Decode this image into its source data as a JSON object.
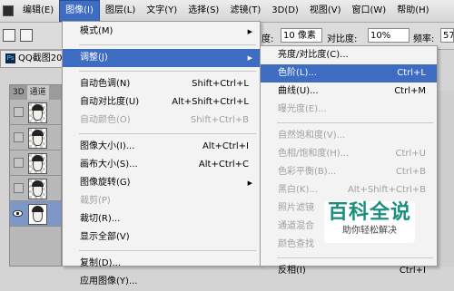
{
  "menubar": {
    "items": [
      "编辑(E)",
      "图像(I)",
      "图层(L)",
      "文字(Y)",
      "选择(S)",
      "滤镜(T)",
      "3D(D)",
      "视图(V)",
      "窗口(W)",
      "帮助(H)"
    ],
    "active_index": 1
  },
  "options": {
    "tolerance_label": "度:",
    "tolerance_value": "10 像素",
    "contrast_label": "对比度:",
    "contrast_value": "10%",
    "frequency_label": "频率:",
    "frequency_value": "57"
  },
  "doc_tab": {
    "ps": "Ps",
    "title": "QQ截图20"
  },
  "layers_panel": {
    "tabs": [
      "3D",
      "通道"
    ],
    "row_count": 5
  },
  "image_menu": {
    "items": [
      {
        "label": "模式(M)",
        "shortcut": "",
        "submenu": true,
        "disabled": false,
        "highlight": false
      },
      {
        "sep": true
      },
      {
        "label": "调整(J)",
        "shortcut": "",
        "submenu": true,
        "disabled": false,
        "highlight": true
      },
      {
        "sep": true
      },
      {
        "label": "自动色调(N)",
        "shortcut": "Shift+Ctrl+L",
        "submenu": false,
        "disabled": false,
        "highlight": false
      },
      {
        "label": "自动对比度(U)",
        "shortcut": "Alt+Shift+Ctrl+L",
        "submenu": false,
        "disabled": false,
        "highlight": false
      },
      {
        "label": "自动颜色(O)",
        "shortcut": "Shift+Ctrl+B",
        "submenu": false,
        "disabled": true,
        "highlight": false
      },
      {
        "sep": true
      },
      {
        "label": "图像大小(I)...",
        "shortcut": "Alt+Ctrl+I",
        "submenu": false,
        "disabled": false,
        "highlight": false
      },
      {
        "label": "画布大小(S)...",
        "shortcut": "Alt+Ctrl+C",
        "submenu": false,
        "disabled": false,
        "highlight": false
      },
      {
        "label": "图像旋转(G)",
        "shortcut": "",
        "submenu": true,
        "disabled": false,
        "highlight": false
      },
      {
        "label": "裁剪(P)",
        "shortcut": "",
        "submenu": false,
        "disabled": true,
        "highlight": false
      },
      {
        "label": "裁切(R)...",
        "shortcut": "",
        "submenu": false,
        "disabled": false,
        "highlight": false
      },
      {
        "label": "显示全部(V)",
        "shortcut": "",
        "submenu": false,
        "disabled": false,
        "highlight": false
      },
      {
        "sep": true
      },
      {
        "label": "复制(D)...",
        "shortcut": "",
        "submenu": false,
        "disabled": false,
        "highlight": false
      },
      {
        "label": "应用图像(Y)...",
        "shortcut": "",
        "submenu": false,
        "disabled": false,
        "highlight": false
      }
    ]
  },
  "adjust_menu": {
    "items": [
      {
        "label": "亮度/对比度(C)...",
        "shortcut": "",
        "disabled": false,
        "highlight": false
      },
      {
        "label": "色阶(L)...",
        "shortcut": "Ctrl+L",
        "disabled": false,
        "highlight": true
      },
      {
        "label": "曲线(U)...",
        "shortcut": "Ctrl+M",
        "disabled": false,
        "highlight": false
      },
      {
        "label": "曝光度(E)...",
        "shortcut": "",
        "disabled": true,
        "highlight": false
      },
      {
        "sep": true
      },
      {
        "label": "自然饱和度(V)...",
        "shortcut": "",
        "disabled": true,
        "highlight": false
      },
      {
        "label": "色相/饱和度(H)...",
        "shortcut": "Ctrl+U",
        "disabled": true,
        "highlight": false
      },
      {
        "label": "色彩平衡(B)...",
        "shortcut": "Ctrl+B",
        "disabled": true,
        "highlight": false
      },
      {
        "label": "黑白(K)...",
        "shortcut": "Alt+Shift+Ctrl+B",
        "disabled": true,
        "highlight": false
      },
      {
        "label": "照片滤镜",
        "shortcut": "",
        "disabled": true,
        "highlight": false
      },
      {
        "label": "通道混合",
        "shortcut": "",
        "disabled": true,
        "highlight": false
      },
      {
        "label": "颜色查找",
        "shortcut": "",
        "disabled": true,
        "highlight": false
      },
      {
        "sep": true
      },
      {
        "label": "反相(I)",
        "shortcut": "Ctrl+I",
        "disabled": false,
        "highlight": false
      }
    ]
  },
  "watermark": {
    "title": "百科全说",
    "subtitle": "助你轻松解决"
  },
  "colors": {
    "highlight": "#3d6cc1",
    "watermark": "#1a8f7e"
  }
}
